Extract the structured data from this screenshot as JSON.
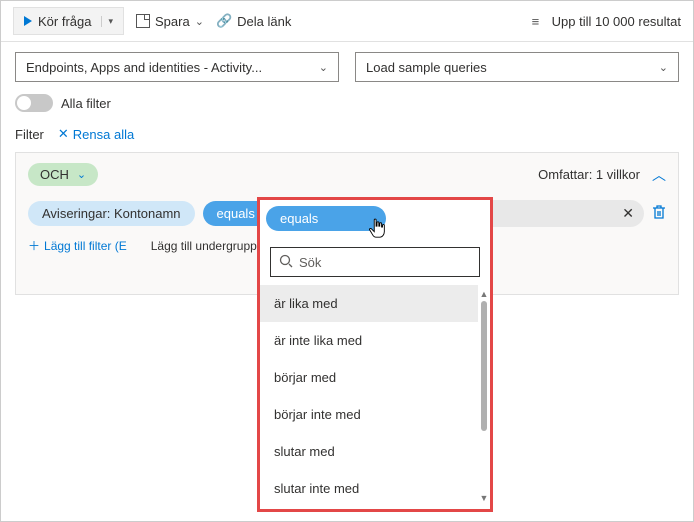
{
  "toolbar": {
    "run_label": "Kör fråga",
    "save_label": "Spara",
    "share_label": "Dela länk",
    "results_label": "Upp till 10 000 resultat"
  },
  "dropdowns": {
    "scope": "Endpoints, Apps and identities - Activity...",
    "samples": "Load sample queries"
  },
  "filters": {
    "all_label": "Alla filter",
    "header_label": "Filter",
    "clear_label": "Rensa alla"
  },
  "group": {
    "logic_label": "OCH",
    "includes_label": "Omfattar: 1 villkor"
  },
  "condition": {
    "field_label": "Aviseringar: Kontonamn",
    "op_label": "equals",
    "value_placeholder": "Sök"
  },
  "actions": {
    "add_filter": "Lägg till filter (E",
    "add_subgroup": "Lägg till undergrupp"
  },
  "op_dropdown": {
    "search_placeholder": "Sök",
    "options": [
      "är lika med",
      "är inte lika med",
      "börjar med",
      "börjar inte med",
      "slutar med",
      "slutar inte med"
    ]
  }
}
